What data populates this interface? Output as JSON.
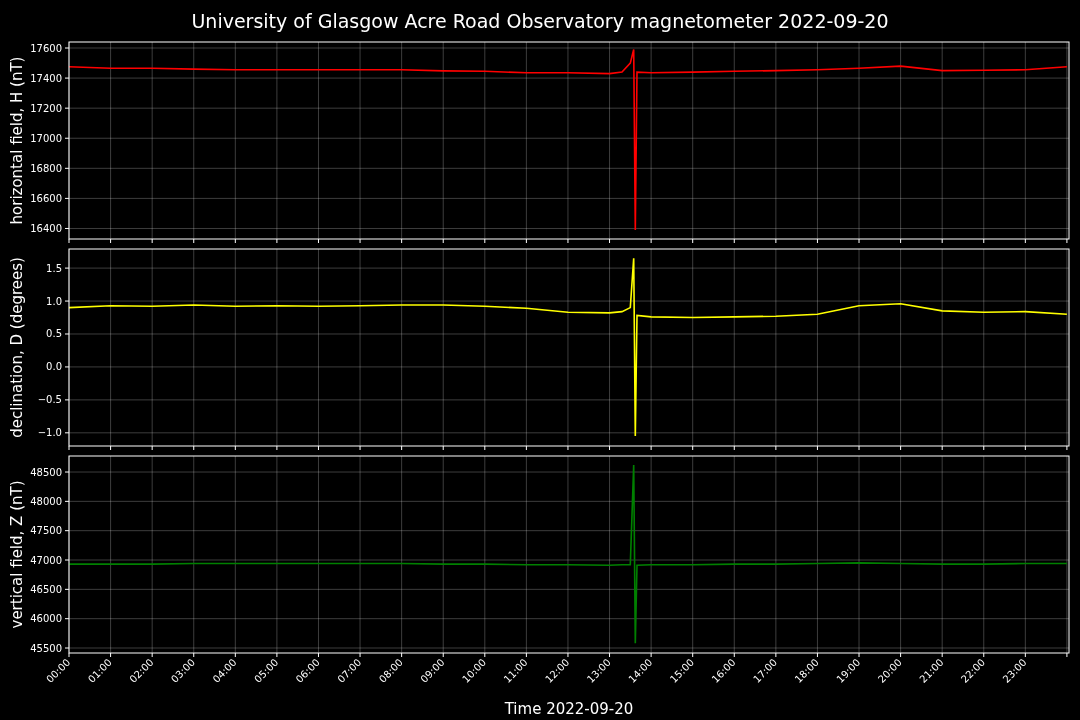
{
  "title": "University of Glasgow Acre Road Observatory magnetometer 2022-09-20",
  "panels": [
    {
      "chart_data": {
        "type": "line",
        "ylabel": "horizontal field, H (nT)",
        "x": [
          0,
          1,
          2,
          3,
          4,
          5,
          6,
          7,
          8,
          9,
          10,
          11,
          12,
          13,
          13.3,
          13.5,
          13.58,
          13.62,
          13.66,
          14,
          15,
          16,
          17,
          18,
          19,
          20,
          21,
          22,
          23,
          24
        ],
        "xlim": [
          0,
          24.05
        ],
        "ylim": [
          16330,
          17640
        ],
        "yticks": [
          16400,
          16600,
          16800,
          17000,
          17200,
          17400,
          17600
        ],
        "grid": true,
        "series": [
          {
            "color": "#ff0000",
            "values": [
              17475,
              17465,
              17465,
              17460,
              17455,
              17455,
              17455,
              17455,
              17455,
              17448,
              17445,
              17435,
              17435,
              17430,
              17440,
              17500,
              17590,
              16390,
              17440,
              17435,
              17440,
              17445,
              17450,
              17455,
              17465,
              17480,
              17450,
              17452,
              17455,
              17475
            ]
          }
        ]
      }
    },
    {
      "chart_data": {
        "type": "line",
        "ylabel": "declination, D (degrees)",
        "x": [
          0,
          1,
          2,
          3,
          4,
          5,
          6,
          7,
          8,
          9,
          10,
          11,
          12,
          13,
          13.3,
          13.5,
          13.58,
          13.62,
          13.66,
          14,
          15,
          16,
          17,
          18,
          19,
          20,
          21,
          22,
          23,
          24
        ],
        "xlim": [
          0,
          24.05
        ],
        "ylim": [
          -1.2,
          1.79
        ],
        "yticks": [
          {
            "value": -1,
            "label": "−1.0"
          },
          {
            "value": -0.5,
            "label": "−0.5"
          },
          {
            "value": 0,
            "label": "0.0"
          },
          {
            "value": 0.5,
            "label": "0.5"
          },
          {
            "value": 1,
            "label": "1.0"
          },
          {
            "value": 1.5,
            "label": "1.5"
          }
        ],
        "grid": true,
        "series": [
          {
            "color": "#ffff00",
            "values": [
              0.9,
              0.93,
              0.92,
              0.94,
              0.92,
              0.93,
              0.92,
              0.93,
              0.94,
              0.94,
              0.92,
              0.89,
              0.83,
              0.82,
              0.84,
              0.9,
              1.65,
              -1.05,
              0.78,
              0.76,
              0.75,
              0.76,
              0.77,
              0.8,
              0.93,
              0.96,
              0.85,
              0.83,
              0.84,
              0.8
            ]
          }
        ]
      }
    },
    {
      "chart_data": {
        "type": "line",
        "ylabel": "vertical field, Z (nT)",
        "xlabel": "Time 2022-09-20",
        "x": [
          0,
          1,
          2,
          3,
          4,
          5,
          6,
          7,
          8,
          9,
          10,
          11,
          12,
          13,
          13.3,
          13.5,
          13.58,
          13.62,
          13.66,
          14,
          15,
          16,
          17,
          18,
          19,
          20,
          21,
          22,
          23,
          24
        ],
        "xlim": [
          0,
          24.05
        ],
        "ylim": [
          45415,
          48773
        ],
        "yticks": [
          45500,
          46000,
          46500,
          47000,
          47500,
          48000,
          48500
        ],
        "xticks": [
          {
            "value": 0,
            "label": "00:00"
          },
          {
            "value": 1,
            "label": "01:00"
          },
          {
            "value": 2,
            "label": "02:00"
          },
          {
            "value": 3,
            "label": "03:00"
          },
          {
            "value": 4,
            "label": "04:00"
          },
          {
            "value": 5,
            "label": "05:00"
          },
          {
            "value": 6,
            "label": "06:00"
          },
          {
            "value": 7,
            "label": "07:00"
          },
          {
            "value": 8,
            "label": "08:00"
          },
          {
            "value": 9,
            "label": "09:00"
          },
          {
            "value": 10,
            "label": "10:00"
          },
          {
            "value": 11,
            "label": "11:00"
          },
          {
            "value": 12,
            "label": "12:00"
          },
          {
            "value": 13,
            "label": "13:00"
          },
          {
            "value": 14,
            "label": "14:00"
          },
          {
            "value": 15,
            "label": "15:00"
          },
          {
            "value": 16,
            "label": "16:00"
          },
          {
            "value": 17,
            "label": "17:00"
          },
          {
            "value": 18,
            "label": "18:00"
          },
          {
            "value": 19,
            "label": "19:00"
          },
          {
            "value": 20,
            "label": "20:00"
          },
          {
            "value": 21,
            "label": "21:00"
          },
          {
            "value": 22,
            "label": "22:00"
          },
          {
            "value": 23,
            "label": "23:00"
          }
        ],
        "grid": true,
        "series": [
          {
            "color": "#008000",
            "values": [
              46930,
              46930,
              46930,
              46940,
              46940,
              46940,
              46940,
              46940,
              46940,
              46930,
              46930,
              46920,
              46920,
              46910,
              46920,
              46920,
              48620,
              45580,
              46910,
              46920,
              46920,
              46930,
              46930,
              46940,
              46950,
              46940,
              46930,
              46930,
              46940,
              46940
            ]
          }
        ]
      }
    }
  ]
}
